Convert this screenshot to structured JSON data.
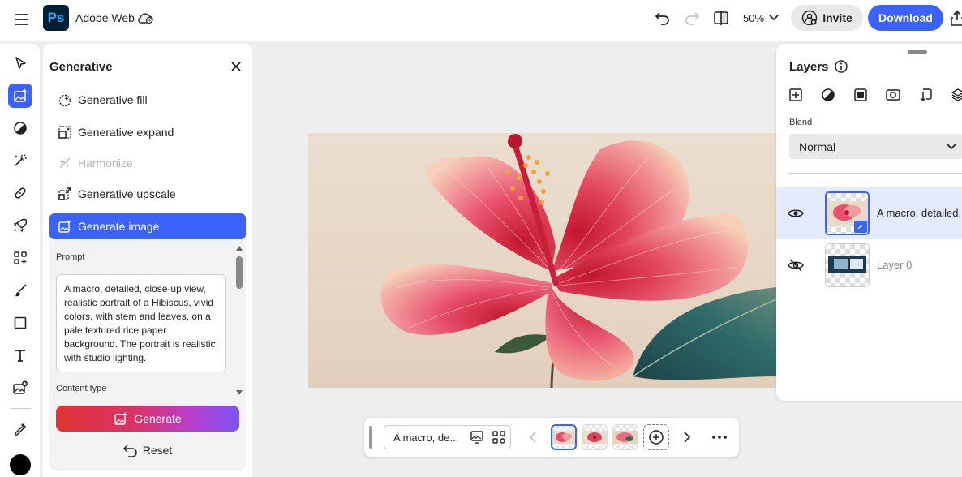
{
  "app": {
    "name": "Adobe Web",
    "logo_text": "Ps"
  },
  "topbar": {
    "zoom": "50%",
    "invite_label": "Invite",
    "download_label": "Download"
  },
  "generative_panel": {
    "title": "Generative",
    "items": [
      {
        "label": "Generative fill",
        "state": "normal"
      },
      {
        "label": "Generative expand",
        "state": "normal"
      },
      {
        "label": "Harmonize",
        "state": "disabled"
      },
      {
        "label": "Generative upscale",
        "state": "normal"
      },
      {
        "label": "Generate image",
        "state": "selected"
      }
    ],
    "prompt_label": "Prompt",
    "prompt_text": "A macro, detailed, close-up view, realistic portrait of a Hibiscus, vivid colors, with stem and leaves, on a pale textured rice paper background. The portrait is realistic with studio lighting.",
    "content_type_label": "Content type",
    "generate_label": "Generate",
    "reset_label": "Reset"
  },
  "layers_panel": {
    "title": "Layers",
    "blend_label": "Blend",
    "blend_value": "Normal",
    "layers": [
      {
        "name": "A macro, detailed,",
        "visible": true,
        "selected": true
      },
      {
        "name": "Layer 0",
        "visible": false,
        "selected": false
      }
    ]
  },
  "bottom_bar": {
    "prompt_preview": "A macro, de..."
  },
  "colors": {
    "accent": "#3b63fb",
    "foreground_color": "#000000"
  }
}
